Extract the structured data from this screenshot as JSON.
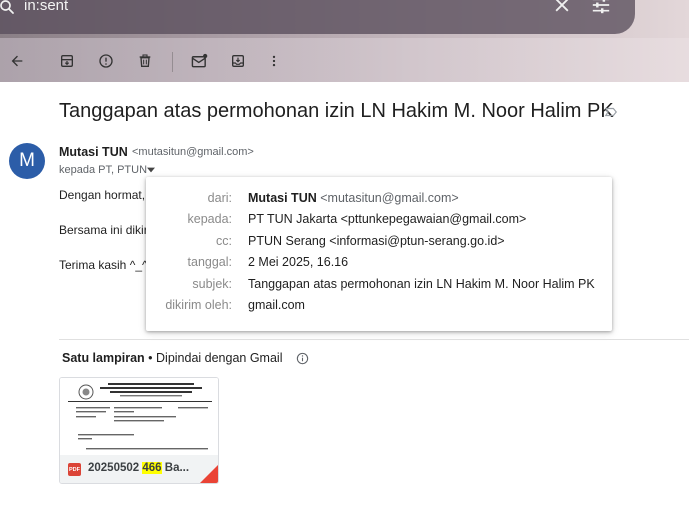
{
  "search": {
    "query": "in:sent"
  },
  "toolbar": {
    "back": "arrow-back-icon",
    "archive": "archive-icon",
    "spam": "report-spam-icon",
    "delete": "trash-icon",
    "mark_unread": "mark-unread-icon",
    "move": "move-to-icon",
    "more": "more-vert-icon"
  },
  "email": {
    "subject": "Tanggapan atas permohonan izin LN Hakim M. Noor Halim PK",
    "avatar_letter": "M",
    "sender_name": "Mutasi TUN",
    "sender_email": "<mutasitun@gmail.com>",
    "to_line": "kepada PT, PTUN",
    "body": {
      "line1": "Dengan hormat,",
      "line2": "Bersama ini dikiri",
      "line3": "Terima kasih ^_^"
    }
  },
  "details": {
    "from_label": "dari:",
    "from_name": "Mutasi TUN",
    "from_email": "<mutasitun@gmail.com>",
    "to_label": "kepada:",
    "to_value": "PT TUN Jakarta <pttunkepegawaian@gmail.com>",
    "cc_label": "cc:",
    "cc_value": "PTUN Serang <informasi@ptun-serang.go.id>",
    "date_label": "tanggal:",
    "date_value": "2 Mei 2025, 16.16",
    "subject_label": "subjek:",
    "subject_value": "Tanggapan atas permohonan izin LN Hakim M. Noor Halim PK",
    "mailedby_label": "dikirim oleh:",
    "mailedby_value": "gmail.com"
  },
  "attachments": {
    "heading": "Satu lampiran",
    "scanned": "Dipindai dengan Gmail",
    "file": {
      "name_prefix": "20250502 ",
      "name_highlight": "466",
      "name_suffix": " Ba...",
      "type": "PDF"
    }
  },
  "colors": {
    "avatar": "#2c5da8",
    "highlight": "#ffff00",
    "pdf": "#db4437"
  }
}
